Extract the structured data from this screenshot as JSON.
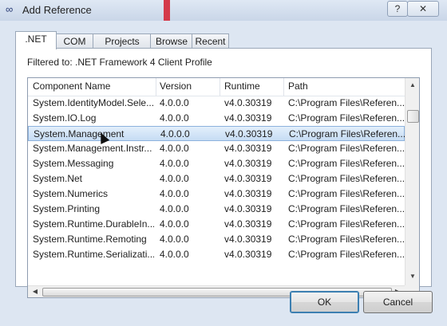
{
  "window": {
    "title": "Add Reference",
    "help_label": "?",
    "close_label": "✕",
    "icon": "references-icon"
  },
  "tabs": [
    {
      "label": ".NET",
      "active": true
    },
    {
      "label": "COM"
    },
    {
      "label": "Projects"
    },
    {
      "label": "Browse"
    },
    {
      "label": "Recent"
    }
  ],
  "filter_text": "Filtered to: .NET Framework 4 Client Profile",
  "columns": [
    "Component Name",
    "Version",
    "Runtime",
    "Path"
  ],
  "rows": [
    {
      "name": "System.IdentityModel.Sele...",
      "version": "4.0.0.0",
      "runtime": "v4.0.30319",
      "path": "C:\\Program Files\\Referen..."
    },
    {
      "name": "System.IO.Log",
      "version": "4.0.0.0",
      "runtime": "v4.0.30319",
      "path": "C:\\Program Files\\Referen..."
    },
    {
      "name": "System.Management",
      "version": "4.0.0.0",
      "runtime": "v4.0.30319",
      "path": "C:\\Program Files\\Referen...",
      "selected": true
    },
    {
      "name": "System.Management.Instr...",
      "version": "4.0.0.0",
      "runtime": "v4.0.30319",
      "path": "C:\\Program Files\\Referen..."
    },
    {
      "name": "System.Messaging",
      "version": "4.0.0.0",
      "runtime": "v4.0.30319",
      "path": "C:\\Program Files\\Referen..."
    },
    {
      "name": "System.Net",
      "version": "4.0.0.0",
      "runtime": "v4.0.30319",
      "path": "C:\\Program Files\\Referen..."
    },
    {
      "name": "System.Numerics",
      "version": "4.0.0.0",
      "runtime": "v4.0.30319",
      "path": "C:\\Program Files\\Referen..."
    },
    {
      "name": "System.Printing",
      "version": "4.0.0.0",
      "runtime": "v4.0.30319",
      "path": "C:\\Program Files\\Referen..."
    },
    {
      "name": "System.Runtime.DurableIn...",
      "version": "4.0.0.0",
      "runtime": "v4.0.30319",
      "path": "C:\\Program Files\\Referen..."
    },
    {
      "name": "System.Runtime.Remoting",
      "version": "4.0.0.0",
      "runtime": "v4.0.30319",
      "path": "C:\\Program Files\\Referen..."
    },
    {
      "name": "System.Runtime.Serializati...",
      "version": "4.0.0.0",
      "runtime": "v4.0.30319",
      "path": "C:\\Program Files\\Referen..."
    }
  ],
  "buttons": {
    "ok": "OK",
    "cancel": "Cancel"
  },
  "colors": {
    "selection": "#c6dcf4",
    "accent": "#3c7fb1"
  }
}
